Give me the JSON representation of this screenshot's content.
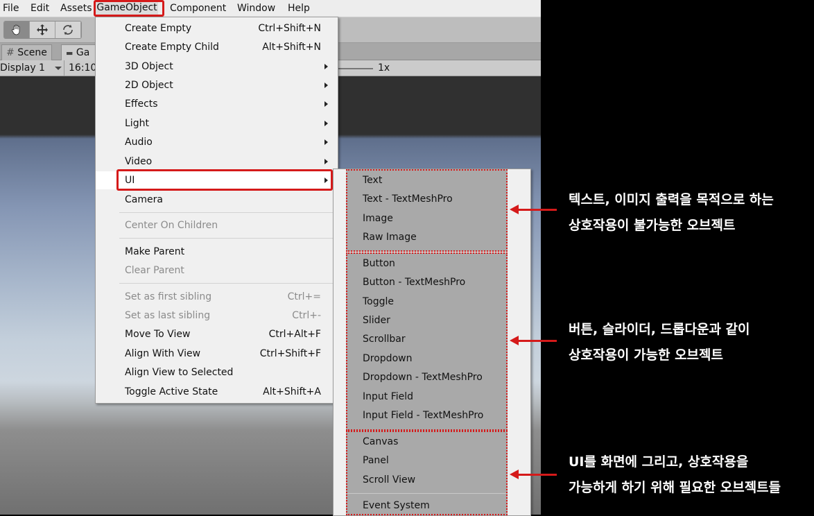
{
  "menubar": {
    "items": [
      "File",
      "Edit",
      "Assets",
      "GameObject",
      "Component",
      "Window",
      "Help"
    ]
  },
  "toolbar": {
    "tools": [
      "hand-icon",
      "move-icon",
      "rotate-icon"
    ]
  },
  "tabs": {
    "scene": "Scene",
    "game": "Ga"
  },
  "gamebar": {
    "display": "Display 1",
    "aspect": "16:10",
    "scale": "1x"
  },
  "gameobject_menu": {
    "items": [
      {
        "label": "Create Empty",
        "shortcut": "Ctrl+Shift+N"
      },
      {
        "label": "Create Empty Child",
        "shortcut": "Alt+Shift+N"
      },
      {
        "label": "3D Object"
      },
      {
        "label": "2D Object"
      },
      {
        "label": "Effects"
      },
      {
        "label": "Light"
      },
      {
        "label": "Audio"
      },
      {
        "label": "Video"
      },
      {
        "label": "UI"
      },
      {
        "label": "Camera"
      },
      {
        "label": "Center On Children"
      },
      {
        "label": "Make Parent"
      },
      {
        "label": "Clear Parent"
      },
      {
        "label": "Set as first sibling",
        "shortcut": "Ctrl+="
      },
      {
        "label": "Set as last sibling",
        "shortcut": "Ctrl+-"
      },
      {
        "label": "Move To View",
        "shortcut": "Ctrl+Alt+F"
      },
      {
        "label": "Align With View",
        "shortcut": "Ctrl+Shift+F"
      },
      {
        "label": "Align View to Selected"
      },
      {
        "label": "Toggle Active State",
        "shortcut": "Alt+Shift+A"
      }
    ]
  },
  "ui_submenu": {
    "group1": [
      "Text",
      "Text - TextMeshPro",
      "Image",
      "Raw Image"
    ],
    "group2": [
      "Button",
      "Button - TextMeshPro",
      "Toggle",
      "Slider",
      "Scrollbar",
      "Dropdown",
      "Dropdown - TextMeshPro",
      "Input Field",
      "Input Field - TextMeshPro"
    ],
    "group3": [
      "Canvas",
      "Panel",
      "Scroll View"
    ],
    "group4": [
      "Event System"
    ]
  },
  "annotations": [
    {
      "line1": "텍스트, 이미지 출력을 목적으로 하는",
      "line2": "상호작용이 불가능한 오브젝트"
    },
    {
      "line1": "버튼, 슬라이더, 드롭다운과 같이",
      "line2": "상호작용이 가능한 오브젝트"
    },
    {
      "line1": "UI를 화면에 그리고, 상호작용을",
      "line2": "가능하게 하기 위해 필요한 오브젝트들"
    }
  ],
  "colors": {
    "highlight_red": "#d51a1a",
    "menu_bg": "#f0f0f0",
    "group_bg": "#a9a9a9"
  }
}
